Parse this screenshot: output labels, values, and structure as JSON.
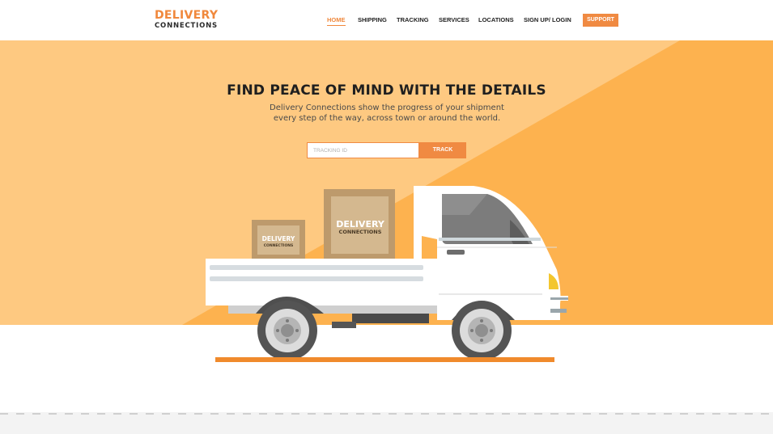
{
  "brand": {
    "name_top": "DELIVERY",
    "name_bottom": "CONNECTIONS"
  },
  "nav": {
    "items": [
      {
        "label": "HOME",
        "active": true
      },
      {
        "label": "SHIPPING",
        "active": false
      },
      {
        "label": "TRACKING",
        "active": false
      },
      {
        "label": "SERVICES",
        "active": false
      },
      {
        "label": "LOCATIONS",
        "active": false
      },
      {
        "label": "SIGN UP/ LOGIN",
        "active": false
      }
    ],
    "support_label": "SUPPORT"
  },
  "hero": {
    "headline": "FIND PEACE OF MIND WITH THE DETAILS",
    "subtext": "Delivery Connections show the progress of your shipment every step of the way, across town or around the world.",
    "tracking_placeholder": "TRACKING ID",
    "tracking_value": "",
    "track_button": "TRACK"
  },
  "illustration": {
    "box_large": {
      "line1": "DELIVERY",
      "line2": "CONNECTIONS"
    },
    "box_small": {
      "line1": "DELIVERY",
      "line2": "CONNECTIONS"
    }
  },
  "colors": {
    "accent": "#f08a42",
    "hero_light": "#fec981",
    "hero_dark": "#fdb24f",
    "text_dark": "#1f1f1f"
  }
}
